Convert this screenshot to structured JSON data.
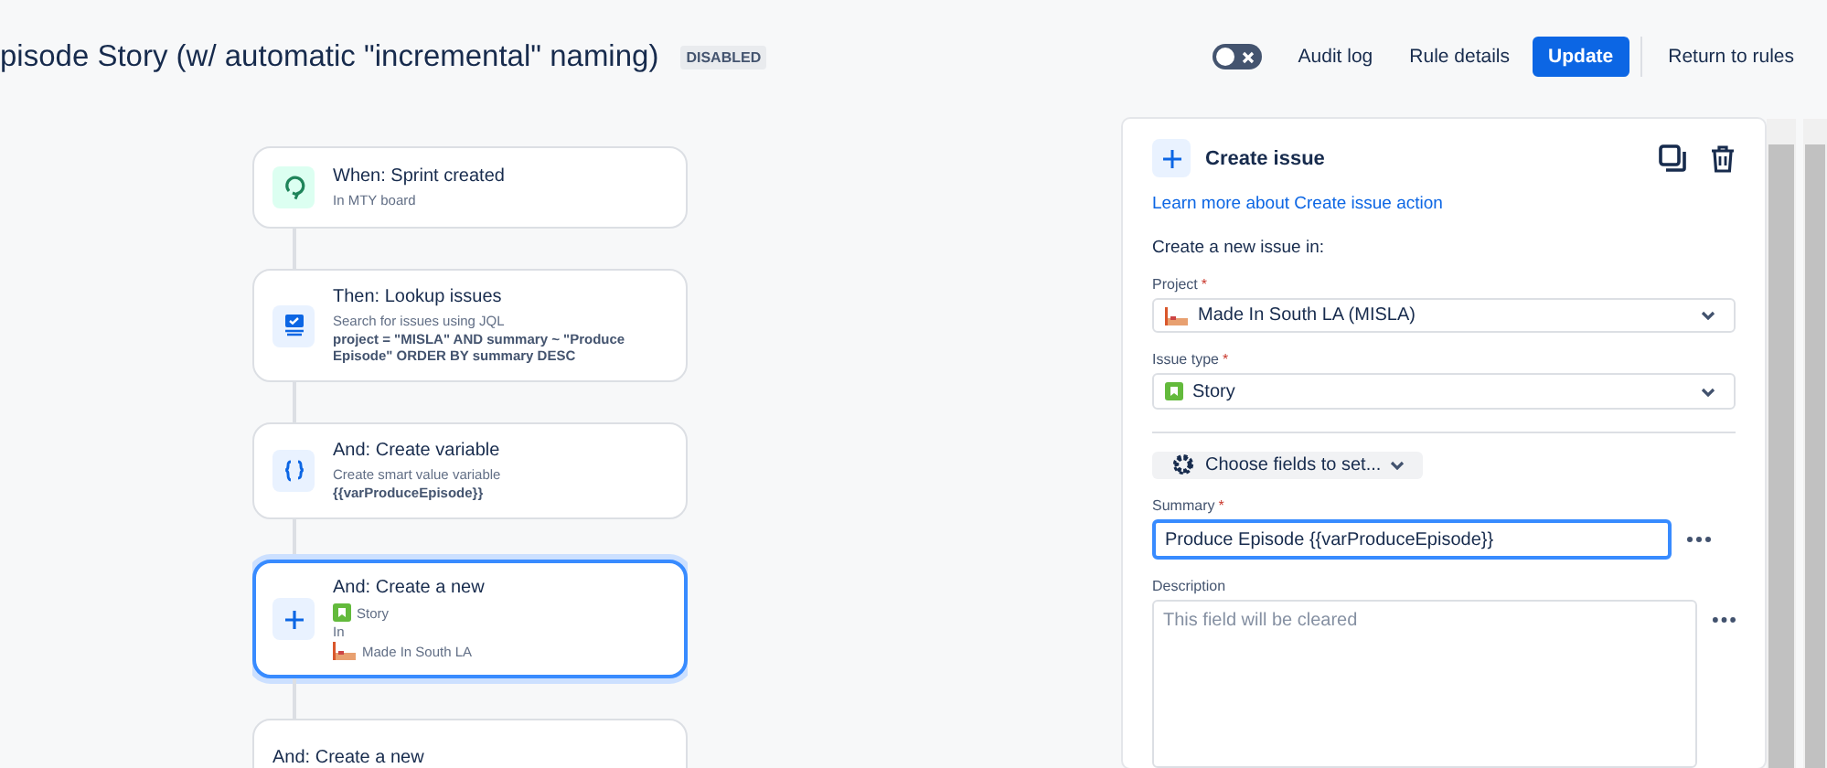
{
  "header": {
    "title": "pisode Story (w/ automatic \"incremental\" naming)",
    "status_badge": "DISABLED",
    "toggle": {
      "on": false
    },
    "actions": [
      {
        "label": "Audit log",
        "kind": "plain"
      },
      {
        "label": "Rule details",
        "kind": "plain"
      },
      {
        "label": "Update",
        "kind": "primary"
      },
      {
        "label": "Return to rules",
        "kind": "plain"
      }
    ]
  },
  "flow": {
    "steps": [
      {
        "kind": "trigger",
        "title": "When: Sprint created",
        "selected": false,
        "lines": [
          {
            "text": "In MTY board",
            "kind": "plain"
          }
        ]
      },
      {
        "kind": "lookup",
        "title": "Then: Lookup issues",
        "selected": false,
        "lines": [
          {
            "text": "Search for issues using JQL",
            "kind": "plain"
          },
          {
            "text": "project = \"MISLA\" AND summary ~ \"Produce Episode\" ORDER BY summary DESC",
            "kind": "bold"
          }
        ]
      },
      {
        "kind": "variable",
        "title": "And: Create variable",
        "selected": false,
        "lines": [
          {
            "text": "Create smart value variable",
            "kind": "plain"
          },
          {
            "text": "{{varProduceEpisode}}",
            "kind": "bold"
          }
        ]
      },
      {
        "kind": "create",
        "title": "And: Create a new",
        "selected": true,
        "lines": [
          {
            "text": "Story",
            "kind": "story"
          },
          {
            "text": "In",
            "kind": "plain"
          },
          {
            "text": "Made In South LA",
            "kind": "project"
          }
        ]
      },
      {
        "kind": "create",
        "title": "And: Create a new",
        "selected": false
      }
    ]
  },
  "panel": {
    "title": "Create issue",
    "learn_more": "Learn more about Create issue action",
    "intro": "Create a new issue in:",
    "project": {
      "label": "Project",
      "required": "*",
      "value": "Made In South LA (MISLA)"
    },
    "issue_type": {
      "label": "Issue type",
      "required": "*",
      "value": "Story"
    },
    "choose_fields": "Choose fields to set...",
    "summary": {
      "label": "Summary",
      "required": "*",
      "value": "Produce Episode {{varProduceEpisode}}",
      "focused": true
    },
    "description": {
      "label": "Description",
      "placeholder": "This field will be cleared"
    }
  }
}
